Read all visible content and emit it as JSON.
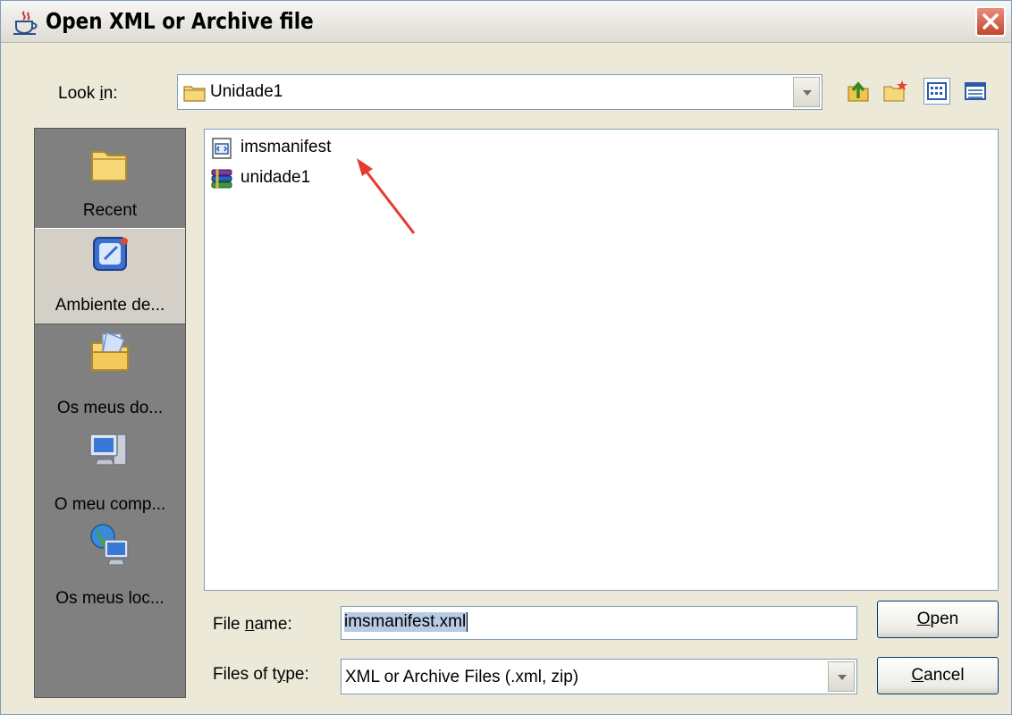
{
  "window": {
    "title": "Open XML or Archive file",
    "title_icon": "java-cup-icon",
    "close_icon": "close-icon"
  },
  "look_in": {
    "label_prefix": "Look ",
    "label_mnemonic": "i",
    "label_suffix": "n:",
    "value": "Unidade1",
    "value_icon": "folder-icon"
  },
  "toolbar": {
    "up_folder_icon": "up-folder-icon",
    "new_folder_icon": "new-folder-icon",
    "list_view_icon": "list-view-icon",
    "details_view_icon": "details-view-icon"
  },
  "places": [
    {
      "label": "Recent",
      "icon": "folder-icon"
    },
    {
      "label": "Ambiente de...",
      "icon": "desktop-icon"
    },
    {
      "label": "Os meus do...",
      "icon": "my-documents-icon"
    },
    {
      "label": "O meu comp...",
      "icon": "my-computer-icon"
    },
    {
      "label": "Os meus loc...",
      "icon": "network-places-icon"
    }
  ],
  "files": [
    {
      "name": "imsmanifest",
      "icon": "xml-file-icon"
    },
    {
      "name": "unidade1",
      "icon": "archive-file-icon"
    }
  ],
  "file_name": {
    "label_prefix": "File ",
    "label_mnemonic": "n",
    "label_suffix": "ame:",
    "value": "imsmanifest.xml"
  },
  "file_type": {
    "label_prefix": "Files of t",
    "label_mnemonic": "y",
    "label_suffix": "pe:",
    "value": "XML or Archive Files (.xml, zip)"
  },
  "buttons": {
    "open_mnemonic": "O",
    "open_rest": "pen",
    "cancel_mnemonic": "C",
    "cancel_rest": "ancel"
  },
  "colors": {
    "dialog_bg": "#ece9d8",
    "places_bg": "#808080",
    "selection": "#b8cbe5",
    "annotation_arrow": "#e53a2f"
  }
}
